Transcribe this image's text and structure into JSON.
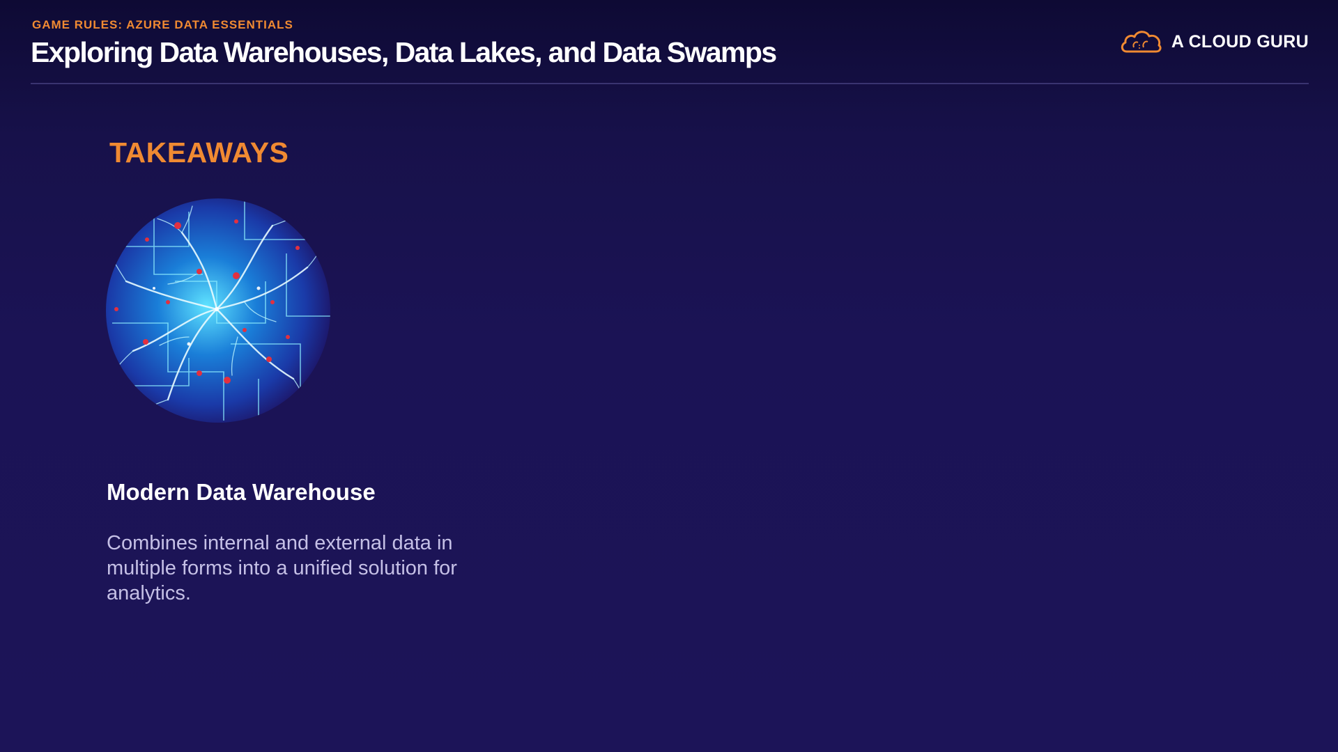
{
  "header": {
    "eyebrow": "GAME RULES: AZURE DATA ESSENTIALS",
    "title": "Exploring Data Warehouses, Data Lakes, and Data Swamps"
  },
  "brand": {
    "name": "A CLOUD GURU",
    "logo_icon": "cloud-icon",
    "accent_color": "#f08a32"
  },
  "section": {
    "heading": "TAKEAWAYS"
  },
  "takeaway": {
    "image_icon": "data-network-sphere",
    "title": "Modern Data Warehouse",
    "description": "Combines internal and external data in multiple forms into a unified solution for analytics."
  },
  "colors": {
    "background": "#1b1355",
    "accent": "#f08a32",
    "body_text": "#c5c0e6"
  }
}
